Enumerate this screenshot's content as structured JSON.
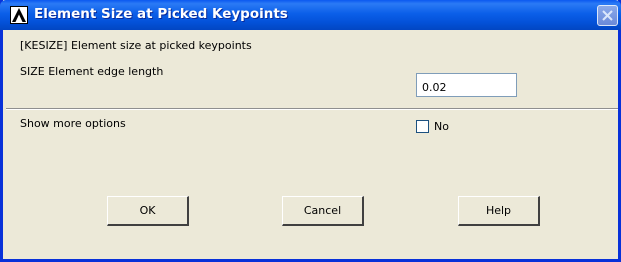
{
  "window": {
    "title": "Element Size at Picked Keypoints"
  },
  "form": {
    "command_line": "[KESIZE]  Element size at picked keypoints",
    "size_label": "SIZE  Element edge length",
    "size_value": "0.02",
    "more_options_label": "Show more options",
    "more_options_checked": false,
    "more_options_value_label": "No"
  },
  "buttons": {
    "ok": "OK",
    "cancel": "Cancel",
    "help": "Help"
  },
  "colors": {
    "titlebar": "#0b5fe9",
    "dialog_background": "#ece9d8",
    "frame_border": "#0831d9"
  },
  "icons": {
    "app": "ansys-logo-icon",
    "close": "close-icon"
  }
}
